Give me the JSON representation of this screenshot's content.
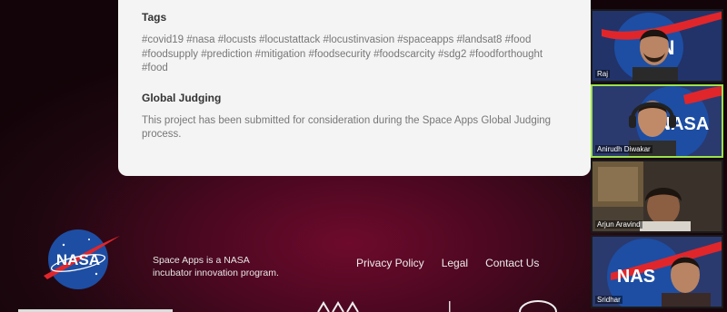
{
  "project": {
    "tags_heading": "Tags",
    "tags_text": "#covid19 #nasa #locusts #locustattack #locustinvasion #spaceapps #landsat8 #food #foodsupply #prediction #mitigation #foodsecurity #foodscarcity #sdg2 #foodforthought #food",
    "judging_heading": "Global Judging",
    "judging_text": "This project has been submitted for consideration during the Space Apps Global Judging process."
  },
  "footer": {
    "tagline_line1": "Space Apps is a NASA",
    "tagline_line2": "incubator innovation program.",
    "links": [
      {
        "label": "Privacy Policy"
      },
      {
        "label": "Legal"
      },
      {
        "label": "Contact Us"
      }
    ],
    "logo_icon": "nasa-meatball-logo"
  },
  "participants": [
    {
      "name": "Raj",
      "active": false
    },
    {
      "name": "Anirudh Diwakar",
      "active": true
    },
    {
      "name": "Arjun Aravind",
      "active": false
    },
    {
      "name": "Sridhar",
      "active": false
    }
  ],
  "colors": {
    "card_bg": "#f4f4f4",
    "footer_bg": "#4a0820",
    "active_speaker_border": "#9be34a",
    "nasa_blue": "#1d4ea3",
    "nasa_red": "#e0262b"
  }
}
